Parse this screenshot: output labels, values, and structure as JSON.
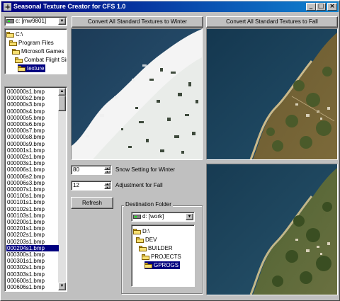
{
  "window": {
    "title": "Seasonal Texture Creator for CFS 1.0",
    "controls": {
      "minimize": "_",
      "maximize": "□",
      "close": "×"
    }
  },
  "drive_select": {
    "value": "c: [mw9801]"
  },
  "source_folders": [
    {
      "label": "C:\\",
      "selected": false
    },
    {
      "label": "Program Files",
      "selected": false
    },
    {
      "label": "Microsoft Games",
      "selected": false
    },
    {
      "label": "Combat Flight Sim",
      "selected": false
    },
    {
      "label": "texture",
      "selected": true
    }
  ],
  "files": [
    "000000s1.bmp",
    "000000s2.bmp",
    "000000s3.bmp",
    "000000s4.bmp",
    "000000s5.bmp",
    "000000s6.bmp",
    "000000s7.bmp",
    "000000s8.bmp",
    "000000s9.bmp",
    "000001s1.bmp",
    "000002s1.bmp",
    "000003s1.bmp",
    "000006s1.bmp",
    "000006s2.bmp",
    "000006s3.bmp",
    "000007s1.bmp",
    "000100s1.bmp",
    "000101s1.bmp",
    "000102s1.bmp",
    "000103s1.bmp",
    "000200s1.bmp",
    "000201s1.bmp",
    "000202s1.bmp",
    "000203s1.bmp",
    "000204s1.bmp",
    "000300s1.bmp",
    "000301s1.bmp",
    "000302s1.bmp",
    "000303s1.bmp",
    "000600s1.bmp",
    "000606s1.bmp"
  ],
  "selected_file": "000204s1.bmp",
  "buttons": {
    "winter": "Convert All Standard Textures to Winter",
    "fall": "Convert All Standard Textures to Fall",
    "refresh": "Refresh"
  },
  "snow_setting": {
    "value": "80",
    "label": "Snow Setting for Winter"
  },
  "fall_adjust": {
    "value": "12",
    "label": "Adjustment for Fall"
  },
  "destination": {
    "group_label": "Destination Folder",
    "drive": "d: [work]",
    "folders": [
      {
        "label": "D:\\",
        "selected": false
      },
      {
        "label": "DEV",
        "selected": false
      },
      {
        "label": "BUILDER",
        "selected": false
      },
      {
        "label": "PROJECTS",
        "selected": false
      },
      {
        "label": "GPROGS",
        "selected": true
      }
    ]
  },
  "colors": {
    "title_start": "#000080",
    "title_end": "#1084d0",
    "selection": "#000080",
    "face": "#c0c0c0"
  }
}
